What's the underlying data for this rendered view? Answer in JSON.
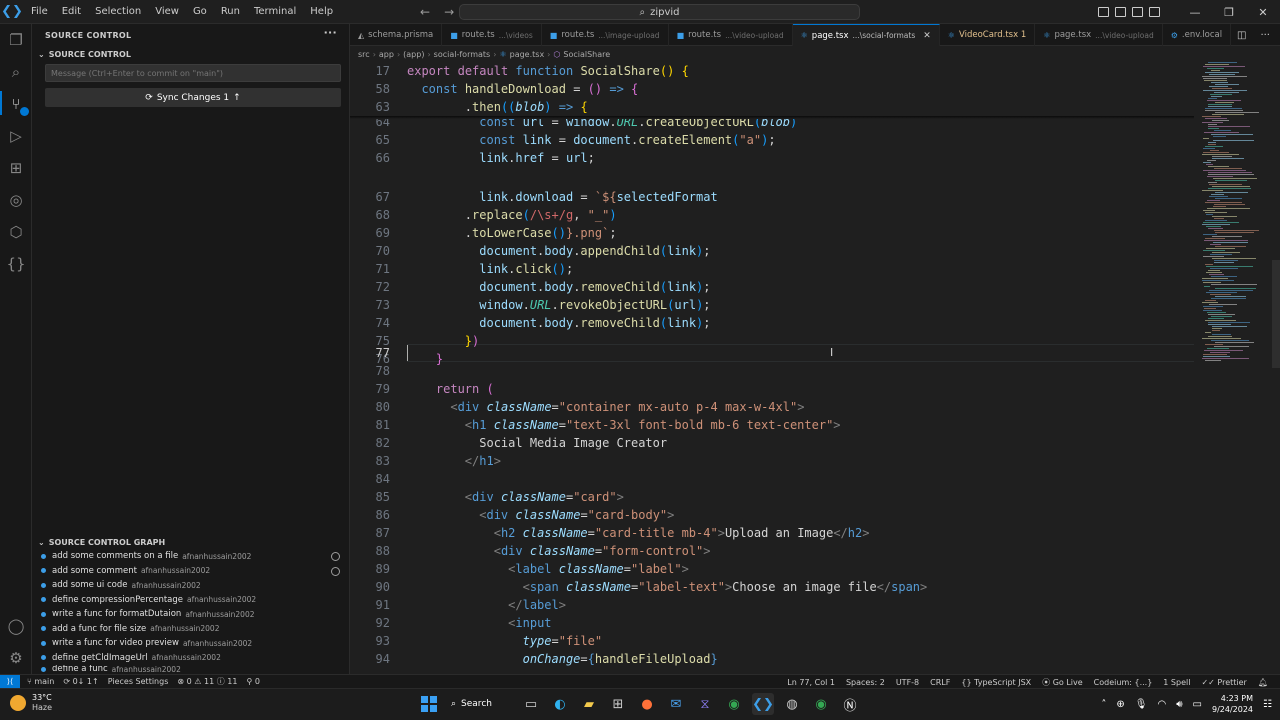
{
  "title_bar": {
    "menu": [
      "File",
      "Edit",
      "Selection",
      "View",
      "Go",
      "Run",
      "Terminal",
      "Help"
    ],
    "search_text": "zipvid"
  },
  "sidebar": {
    "header": "SOURCE CONTROL",
    "section": "SOURCE CONTROL",
    "commit_placeholder": "Message (Ctrl+Enter to commit on \"main\")",
    "sync_label": "Sync Changes 1",
    "graph_header": "SOURCE CONTROL GRAPH",
    "graph": [
      {
        "message": "add some comments on a file",
        "author": "afnanhussain2002"
      },
      {
        "message": "add some comment",
        "author": "afnanhussain2002"
      },
      {
        "message": "add some ui code",
        "author": "afnanhussain2002"
      },
      {
        "message": "define compressionPercentage",
        "author": "afnanhussain2002"
      },
      {
        "message": "write a func for formatDutaion",
        "author": "afnanhussain2002"
      },
      {
        "message": "add a func for file size",
        "author": "afnanhussain2002"
      },
      {
        "message": "write a func for video preview",
        "author": "afnanhussain2002"
      },
      {
        "message": "define getCldImageUrl",
        "author": "afnanhussain2002"
      },
      {
        "message": "define a func",
        "author": "afnanhussain2002"
      }
    ]
  },
  "tabs": [
    {
      "name": "schema.prisma",
      "desc": ""
    },
    {
      "name": "route.ts",
      "desc": "...\\videos"
    },
    {
      "name": "route.ts",
      "desc": "...\\image-upload"
    },
    {
      "name": "route.ts",
      "desc": "...\\video-upload"
    },
    {
      "name": "page.tsx",
      "desc": "...\\social-formats"
    },
    {
      "name": "VideoCard.tsx 1",
      "desc": ""
    },
    {
      "name": "page.tsx",
      "desc": "...\\video-upload"
    },
    {
      "name": ".env.local",
      "desc": ""
    }
  ],
  "breadcrumb": [
    "src",
    "app",
    "(app)",
    "social-formats",
    "page.tsx",
    "SocialShare"
  ],
  "editor": {
    "line_numbers": [
      "17",
      "58",
      "63",
      "64",
      "65",
      "66",
      "67",
      "68",
      "69",
      "70",
      "71",
      "72",
      "73",
      "74",
      "75",
      "76",
      "77",
      "78",
      "79",
      "80",
      "81",
      "82",
      "83",
      "84",
      "85",
      "86",
      "87",
      "88",
      "89",
      "90",
      "91",
      "92",
      "93",
      "94"
    ]
  },
  "status": {
    "branch": "main",
    "sync": "0↓ 1↑",
    "pieces": "Pieces Settings",
    "problems": "0",
    "warnings": "11",
    "info": "11",
    "ports": "0",
    "position": "Ln 77, Col 1",
    "spaces": "Spaces: 2",
    "encoding": "UTF-8",
    "eol": "CRLF",
    "language": "TypeScript JSX",
    "golive": "Go Live",
    "codeium": "Codeium: {...}",
    "spell": "1 Spell",
    "prettier": "Prettier"
  },
  "taskbar": {
    "temp": "33°C",
    "condition": "Haze",
    "search": "Search",
    "time": "4:23 PM",
    "date": "9/24/2024"
  }
}
